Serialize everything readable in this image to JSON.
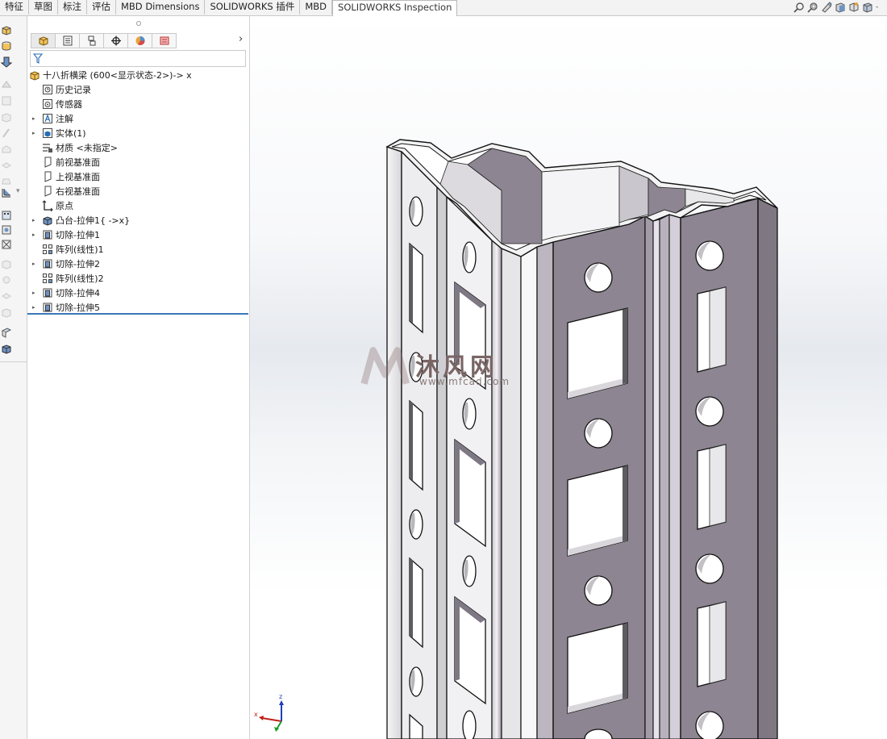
{
  "tabs": [
    {
      "label": "特征"
    },
    {
      "label": "草图"
    },
    {
      "label": "标注"
    },
    {
      "label": "评估"
    },
    {
      "label": "MBD Dimensions"
    },
    {
      "label": "SOLIDWORKS 插件"
    },
    {
      "label": "MBD"
    },
    {
      "label": "SOLIDWORKS Inspection"
    }
  ],
  "active_tab": "SOLIDWORKS Inspection",
  "view_tools": [
    "zoom-to-fit-icon",
    "zoom-area-icon",
    "previous-view-icon",
    "section-view-icon",
    "view-orientation-icon",
    "display-style-icon"
  ],
  "panel": {
    "tabs": [
      "feature-manager-icon",
      "property-manager-icon",
      "configuration-manager-icon",
      "dimxpert-icon",
      "display-manager-icon",
      "cam-icon"
    ],
    "more": "›"
  },
  "tree": {
    "root": "十八折横梁  (600<显示状态-2>)-> x",
    "items": [
      {
        "label": "历史记录",
        "icon": "history-icon",
        "expandable": false
      },
      {
        "label": "传感器",
        "icon": "sensor-icon",
        "expandable": false
      },
      {
        "label": "注解",
        "icon": "annotation-icon",
        "expandable": true
      },
      {
        "label": "实体(1)",
        "icon": "solid-body-icon",
        "expandable": true
      },
      {
        "label": "材质 <未指定>",
        "icon": "material-icon",
        "expandable": false
      },
      {
        "label": "前视基准面",
        "icon": "plane-icon",
        "expandable": false
      },
      {
        "label": "上视基准面",
        "icon": "plane-icon",
        "expandable": false
      },
      {
        "label": "右视基准面",
        "icon": "plane-icon",
        "expandable": false
      },
      {
        "label": "原点",
        "icon": "origin-icon",
        "expandable": false
      },
      {
        "label": "凸台-拉伸1{ ->x}",
        "icon": "boss-extrude-icon",
        "expandable": true
      },
      {
        "label": "切除-拉伸1",
        "icon": "cut-extrude-icon",
        "expandable": true
      },
      {
        "label": "阵列(线性)1",
        "icon": "linear-pattern-icon",
        "expandable": false
      },
      {
        "label": "切除-拉伸2",
        "icon": "cut-extrude-icon",
        "expandable": true
      },
      {
        "label": "阵列(线性)2",
        "icon": "linear-pattern-icon",
        "expandable": false
      },
      {
        "label": "切除-拉伸4",
        "icon": "cut-extrude-icon",
        "expandable": true
      },
      {
        "label": "切除-拉伸5",
        "icon": "cut-extrude-icon",
        "expandable": true
      }
    ]
  },
  "watermark": {
    "text": "沐风网",
    "url": "www.mfcad.com"
  },
  "triad": {
    "x": "x",
    "z": "z"
  },
  "colors": {
    "accent": "#3b78b5",
    "part_face": "#8d8591",
    "part_light": "#e9e9eb"
  }
}
